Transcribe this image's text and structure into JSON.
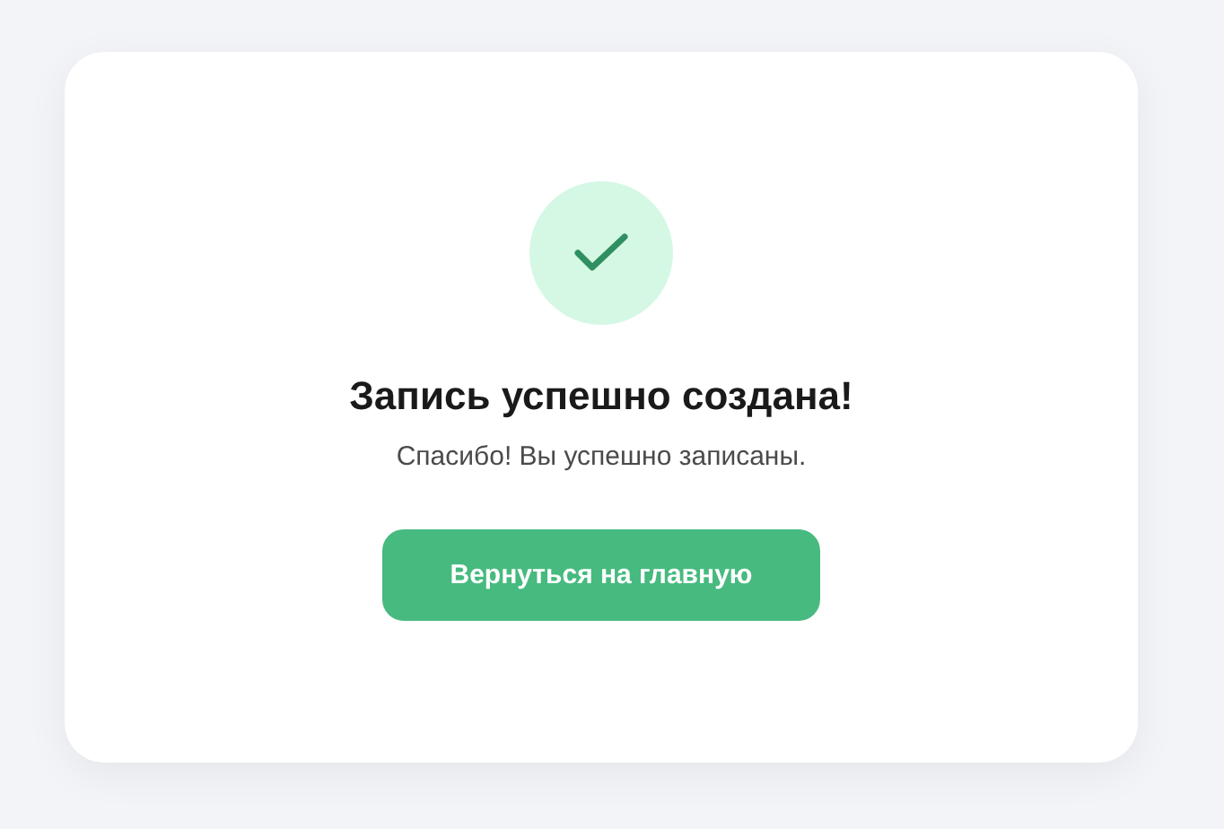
{
  "card": {
    "title": "Запись успешно создана!",
    "message": "Спасибо! Вы успешно записаны.",
    "button": "Вернуться на главную"
  }
}
